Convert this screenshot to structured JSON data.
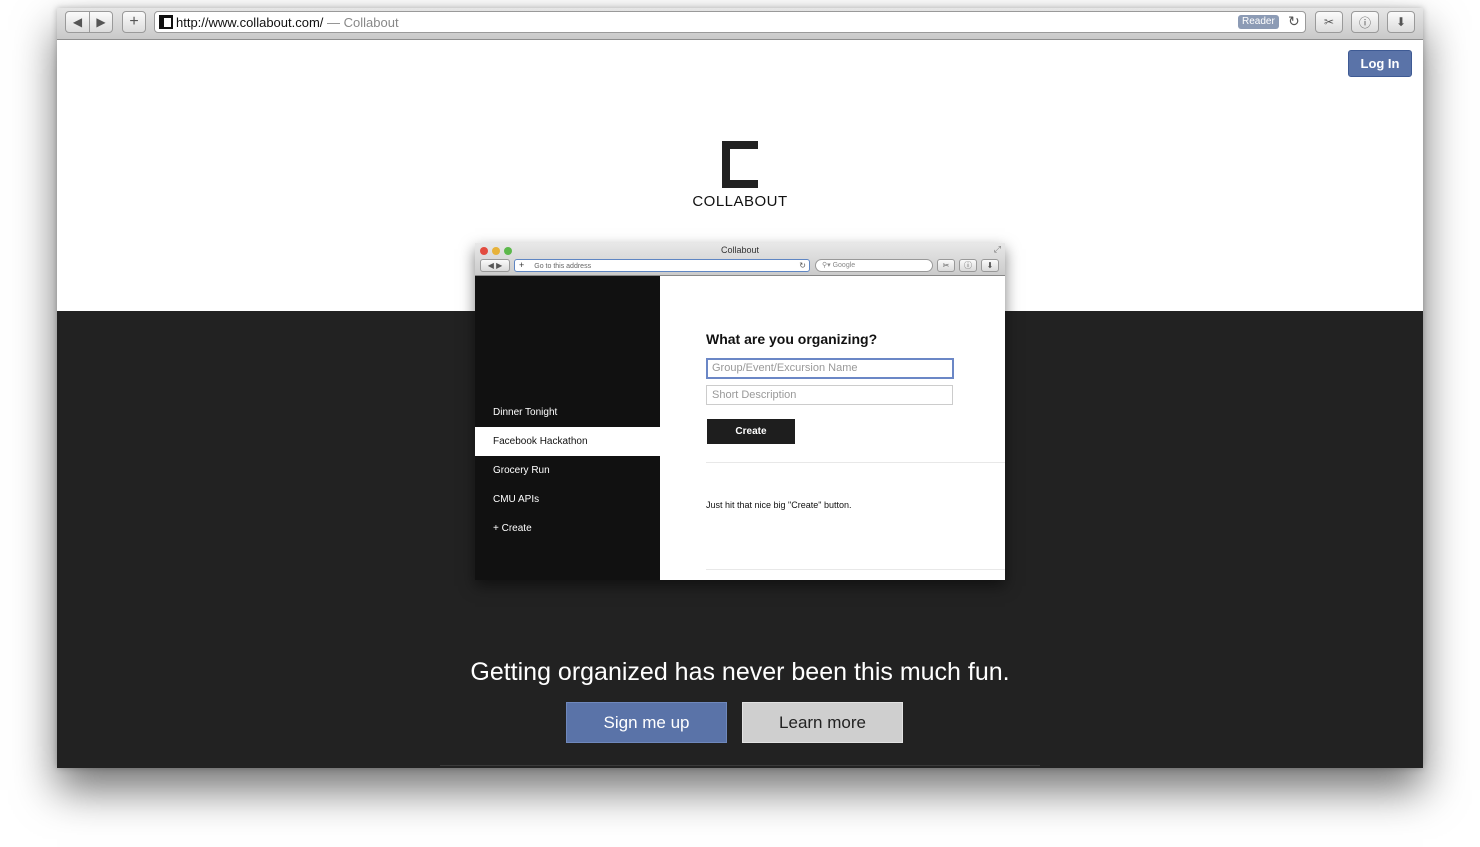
{
  "browser": {
    "url": "http://www.collabout.com/",
    "title_suffix": " — Collabout",
    "reader_label": "Reader"
  },
  "header": {
    "login_label": "Log In"
  },
  "logo": {
    "text": "COLLABOUT"
  },
  "preview": {
    "window_title": "Collabout",
    "address_placeholder": "Go to this address",
    "search_placeholder": "Google",
    "sidebar": {
      "items": [
        {
          "label": "Dinner Tonight"
        },
        {
          "label": "Facebook Hackathon"
        },
        {
          "label": "Grocery Run"
        },
        {
          "label": "CMU APIs"
        },
        {
          "label": "+ Create"
        }
      ],
      "active_index": 1
    },
    "form": {
      "heading": "What are you organizing?",
      "name_placeholder": "Group/Event/Excursion Name",
      "description_placeholder": "Short Description",
      "create_label": "Create",
      "hint": "Just hit that nice big \"Create\" button."
    }
  },
  "hero": {
    "tagline": "Getting organized has never been this much fun.",
    "signup_label": "Sign me up",
    "learn_label": "Learn more"
  },
  "colors": {
    "accent": "#5a73a8",
    "dark_band": "#222222",
    "sidebar": "#111111"
  }
}
